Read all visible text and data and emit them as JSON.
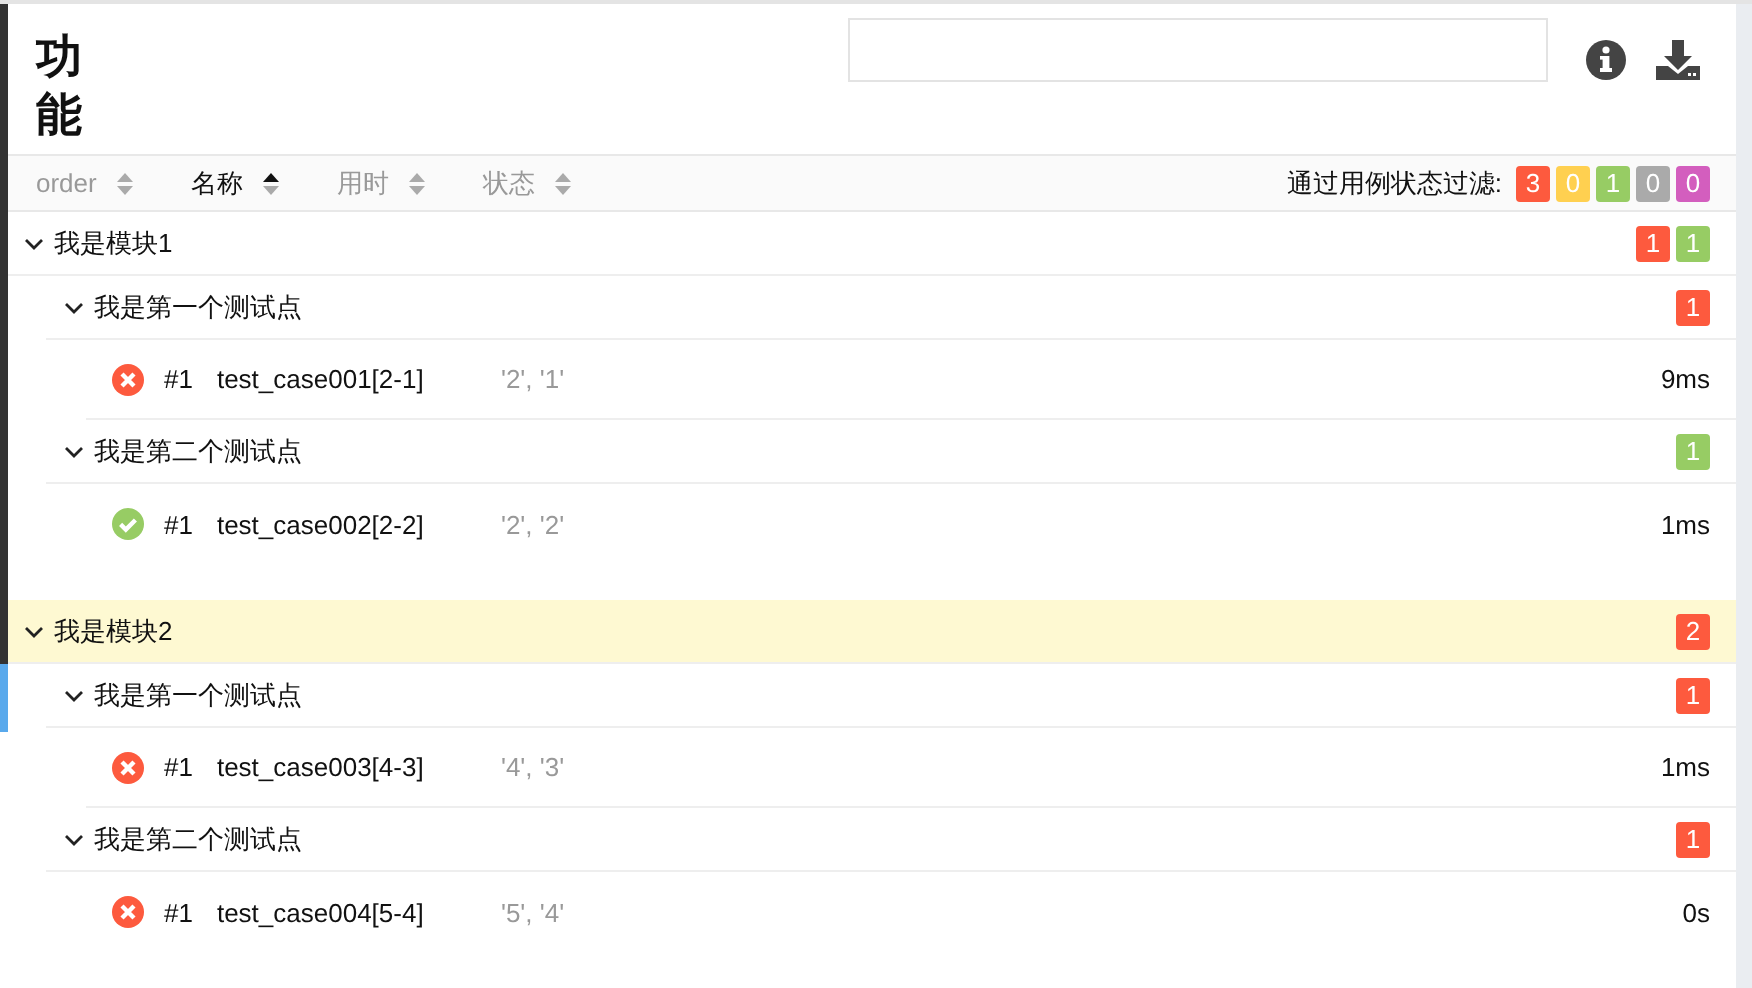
{
  "title": "功能",
  "sort_columns": [
    {
      "label": "order",
      "selected": false
    },
    {
      "label": "名称",
      "selected": true
    },
    {
      "label": "用时",
      "selected": false
    },
    {
      "label": "状态",
      "selected": false
    }
  ],
  "filter": {
    "label": "通过用例状态过滤:",
    "badges": [
      {
        "count": "3",
        "color": "#fd5a3e"
      },
      {
        "count": "0",
        "color": "#ffd050"
      },
      {
        "count": "1",
        "color": "#97cc64"
      },
      {
        "count": "0",
        "color": "#aaaaaa"
      },
      {
        "count": "0",
        "color": "#d35ebe"
      }
    ]
  },
  "modules": [
    {
      "name": "我是模块1",
      "expanded": true,
      "selected": false,
      "badges": [
        {
          "count": "1",
          "color": "#fd5a3e"
        },
        {
          "count": "1",
          "color": "#97cc64"
        }
      ],
      "children": [
        {
          "name": "我是第一个测试点",
          "expanded": true,
          "badges": [
            {
              "count": "1",
              "color": "#fd5a3e"
            }
          ],
          "children": [
            {
              "kind": "failed",
              "order": "#1",
              "name": "test_case001[2-1]",
              "params": "'2', '1'",
              "duration": "9ms"
            }
          ]
        },
        {
          "name": "我是第二个测试点",
          "expanded": true,
          "badges": [
            {
              "count": "1",
              "color": "#97cc64"
            }
          ],
          "children": [
            {
              "kind": "passed",
              "order": "#1",
              "name": "test_case002[2-2]",
              "params": "'2', '2'",
              "duration": "1ms"
            }
          ]
        }
      ]
    },
    {
      "name": "我是模块2",
      "expanded": true,
      "selected": true,
      "badges": [
        {
          "count": "2",
          "color": "#fd5a3e"
        }
      ],
      "children": [
        {
          "name": "我是第一个测试点",
          "expanded": true,
          "badges": [
            {
              "count": "1",
              "color": "#fd5a3e"
            }
          ],
          "children": [
            {
              "kind": "failed",
              "order": "#1",
              "name": "test_case003[4-3]",
              "params": "'4', '3'",
              "duration": "1ms"
            }
          ]
        },
        {
          "name": "我是第二个测试点",
          "expanded": true,
          "badges": [
            {
              "count": "1",
              "color": "#fd5a3e"
            }
          ],
          "children": [
            {
              "kind": "failed",
              "order": "#1",
              "name": "test_case004[5-4]",
              "params": "'5', '4'",
              "duration": "0s"
            }
          ]
        }
      ]
    }
  ]
}
